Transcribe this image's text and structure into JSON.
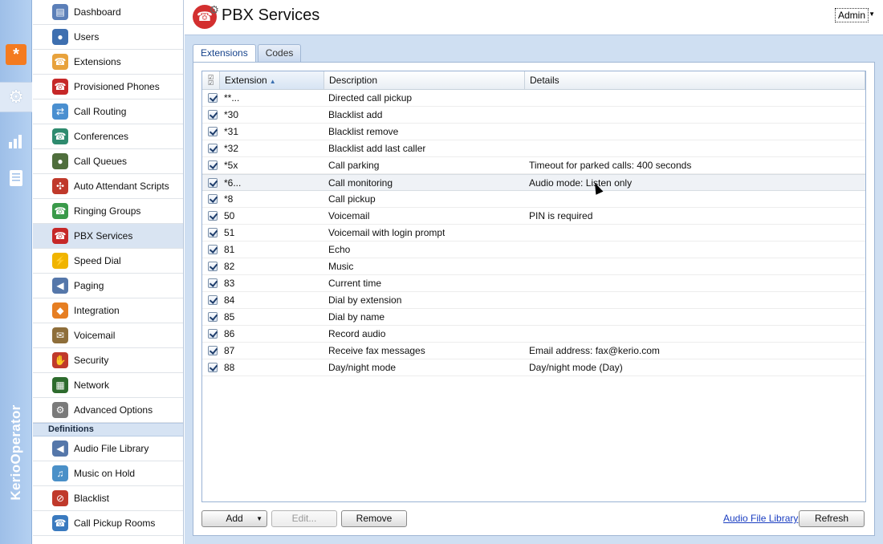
{
  "brand": "KerioOperator",
  "rail": {
    "items": [
      {
        "name": "operator-icon",
        "active": false
      },
      {
        "name": "configuration-gear-icon",
        "active": true
      },
      {
        "name": "status-bars-icon",
        "active": false
      },
      {
        "name": "logs-document-icon",
        "active": false
      }
    ]
  },
  "sidebar": {
    "items": [
      {
        "label": "Dashboard",
        "icon": "dashboard-icon",
        "color": "#5b7fb8",
        "glyph": "▤"
      },
      {
        "label": "Users",
        "icon": "users-icon",
        "color": "#3e6fb0",
        "glyph": "●"
      },
      {
        "label": "Extensions",
        "icon": "extensions-phone-icon",
        "color": "#e8a23c",
        "glyph": "☎"
      },
      {
        "label": "Provisioned Phones",
        "icon": "provisioned-phones-icon",
        "color": "#c62828",
        "glyph": "☎"
      },
      {
        "label": "Call Routing",
        "icon": "call-routing-icon",
        "color": "#4a8fd0",
        "glyph": "⇄"
      },
      {
        "label": "Conferences",
        "icon": "conferences-icon",
        "color": "#2e8b6f",
        "glyph": "☎"
      },
      {
        "label": "Call Queues",
        "icon": "call-queues-icon",
        "color": "#4f6e3c",
        "glyph": "●"
      },
      {
        "label": "Auto Attendant Scripts",
        "icon": "auto-attendant-icon",
        "color": "#c0392b",
        "glyph": "✣"
      },
      {
        "label": "Ringing Groups",
        "icon": "ringing-groups-icon",
        "color": "#3a9a4a",
        "glyph": "☎"
      },
      {
        "label": "PBX Services",
        "icon": "pbx-services-icon",
        "color": "#c62828",
        "glyph": "☎"
      },
      {
        "label": "Speed Dial",
        "icon": "speed-dial-icon",
        "color": "#f0b400",
        "glyph": "⚡"
      },
      {
        "label": "Paging",
        "icon": "paging-icon",
        "color": "#5577aa",
        "glyph": "◀"
      },
      {
        "label": "Integration",
        "icon": "integration-icon",
        "color": "#e67e22",
        "glyph": "◆"
      },
      {
        "label": "Voicemail",
        "icon": "voicemail-icon",
        "color": "#8e6e3a",
        "glyph": "✉"
      },
      {
        "label": "Security",
        "icon": "security-icon",
        "color": "#c0392b",
        "glyph": "✋"
      },
      {
        "label": "Network",
        "icon": "network-icon",
        "color": "#2d6b2d",
        "glyph": "▦"
      },
      {
        "label": "Advanced Options",
        "icon": "advanced-options-icon",
        "color": "#7a7a7a",
        "glyph": "⚙"
      }
    ],
    "section_label": "Definitions",
    "definitions": [
      {
        "label": "Audio File Library",
        "icon": "audio-file-library-icon",
        "color": "#5577aa",
        "glyph": "◀"
      },
      {
        "label": "Music on Hold",
        "icon": "music-on-hold-icon",
        "color": "#4a90c8",
        "glyph": "♫"
      },
      {
        "label": "Blacklist",
        "icon": "blacklist-icon",
        "color": "#c0392b",
        "glyph": "⊘"
      },
      {
        "label": "Call Pickup Rooms",
        "icon": "call-pickup-rooms-icon",
        "color": "#3a7abf",
        "glyph": "☎"
      }
    ],
    "active_index": 9
  },
  "header": {
    "title": "PBX Services",
    "user_menu": "Admin"
  },
  "tabs": [
    {
      "label": "Extensions",
      "active": true
    },
    {
      "label": "Codes",
      "active": false
    }
  ],
  "grid": {
    "columns": [
      {
        "label": "Extension",
        "sorted": true
      },
      {
        "label": "Description",
        "sorted": false
      },
      {
        "label": "Details",
        "sorted": false
      }
    ],
    "rows": [
      {
        "ext": "**...",
        "desc": "Directed call pickup",
        "details": ""
      },
      {
        "ext": "*30",
        "desc": "Blacklist add",
        "details": ""
      },
      {
        "ext": "*31",
        "desc": "Blacklist remove",
        "details": ""
      },
      {
        "ext": "*32",
        "desc": "Blacklist add last caller",
        "details": ""
      },
      {
        "ext": "*5x",
        "desc": "Call parking",
        "details": "Timeout for parked calls: 400 seconds"
      },
      {
        "ext": "*6...",
        "desc": "Call monitoring",
        "details": "Audio mode: Listen only"
      },
      {
        "ext": "*8",
        "desc": "Call pickup",
        "details": ""
      },
      {
        "ext": "50",
        "desc": "Voicemail",
        "details": "PIN is required"
      },
      {
        "ext": "51",
        "desc": "Voicemail with login prompt",
        "details": ""
      },
      {
        "ext": "81",
        "desc": "Echo",
        "details": ""
      },
      {
        "ext": "82",
        "desc": "Music",
        "details": ""
      },
      {
        "ext": "83",
        "desc": "Current time",
        "details": ""
      },
      {
        "ext": "84",
        "desc": "Dial by extension",
        "details": ""
      },
      {
        "ext": "85",
        "desc": "Dial by name",
        "details": ""
      },
      {
        "ext": "86",
        "desc": "Record audio",
        "details": ""
      },
      {
        "ext": "87",
        "desc": "Receive fax messages",
        "details": "Email address: fax@kerio.com"
      },
      {
        "ext": "88",
        "desc": "Day/night mode",
        "details": "Day/night mode (Day)"
      }
    ],
    "hover_row": 5
  },
  "footer": {
    "add_label": "Add",
    "edit_label": "Edit...",
    "remove_label": "Remove",
    "audio_link": "Audio File Library",
    "refresh_label": "Refresh"
  }
}
